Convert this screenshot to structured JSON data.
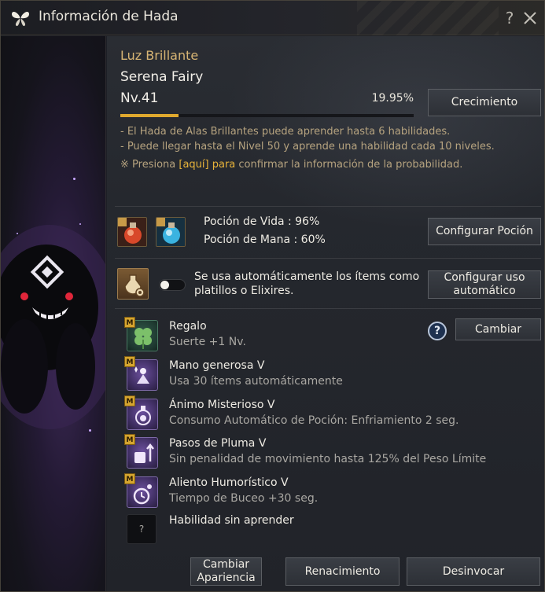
{
  "window": {
    "title": "Información de Hada",
    "title_icon": "butterfly-icon",
    "help_label": "?",
    "close_icon": "close-icon"
  },
  "fairy": {
    "label": "Luz Brillante",
    "name": "Serena Fairy",
    "level": "Nv.41",
    "exp_percent_text": "19.95%",
    "exp_fraction": 0.1995,
    "grow_button": "Crecimiento"
  },
  "description": {
    "line1": "- El Hada de Alas Brillantes puede aprender hasta 6 habilidades.",
    "line2": "- Puede llegar hasta el Nivel 50 y aprende una habilidad cada 10 niveles.",
    "line3_prefix": "※ Presiona ",
    "line3_link": "[aquí] para",
    "line3_suffix": " confirmar la información de la probabilidad."
  },
  "potions": {
    "life_label": "Poción de Vida : 96%",
    "mana_label": "Poción de Mana : 60%",
    "life_icon": "red-potion-icon",
    "mana_icon": "blue-potion-icon",
    "configure_button": "Configurar Poción"
  },
  "auto_use": {
    "icon": "elixir-gear-icon",
    "toggle_on": false,
    "text": "Se usa automáticamente los ítems como platillos o Elixires.",
    "configure_button": "Configurar uso automático"
  },
  "skills": [
    {
      "badge": "M",
      "name": "Regalo",
      "desc": "Suerte +1 Nv.",
      "icon": "clover-icon"
    },
    {
      "badge": "M",
      "name": "Mano generosa V",
      "desc": "Usa 30 ítems automáticamente",
      "icon": "sparkle-hand-icon"
    },
    {
      "badge": "M",
      "name": "Ánimo Misterioso V",
      "desc": "Consumo Automático de Poción: Enfriamiento 2 seg.",
      "icon": "potion-swirl-icon"
    },
    {
      "badge": "M",
      "name": "Pasos de Pluma V",
      "desc": "Sin penalidad de movimiento hasta 125% del Peso Límite",
      "icon": "weight-arrow-icon"
    },
    {
      "badge": "M",
      "name": "Aliento Humorístico V",
      "desc": "Tiempo de Buceo +30 seg.",
      "icon": "bubble-clock-icon"
    },
    {
      "badge": "",
      "name": "Habilidad sin aprender",
      "desc": "",
      "icon": "unknown-skill-icon",
      "placeholder": "?"
    }
  ],
  "skill_actions": {
    "help_label": "?",
    "change_button": "Cambiar"
  },
  "footer": {
    "appearance_button": "Cambiar Apariencia",
    "rebirth_button": "Renacimiento",
    "dismiss_button": "Desinvocar"
  }
}
